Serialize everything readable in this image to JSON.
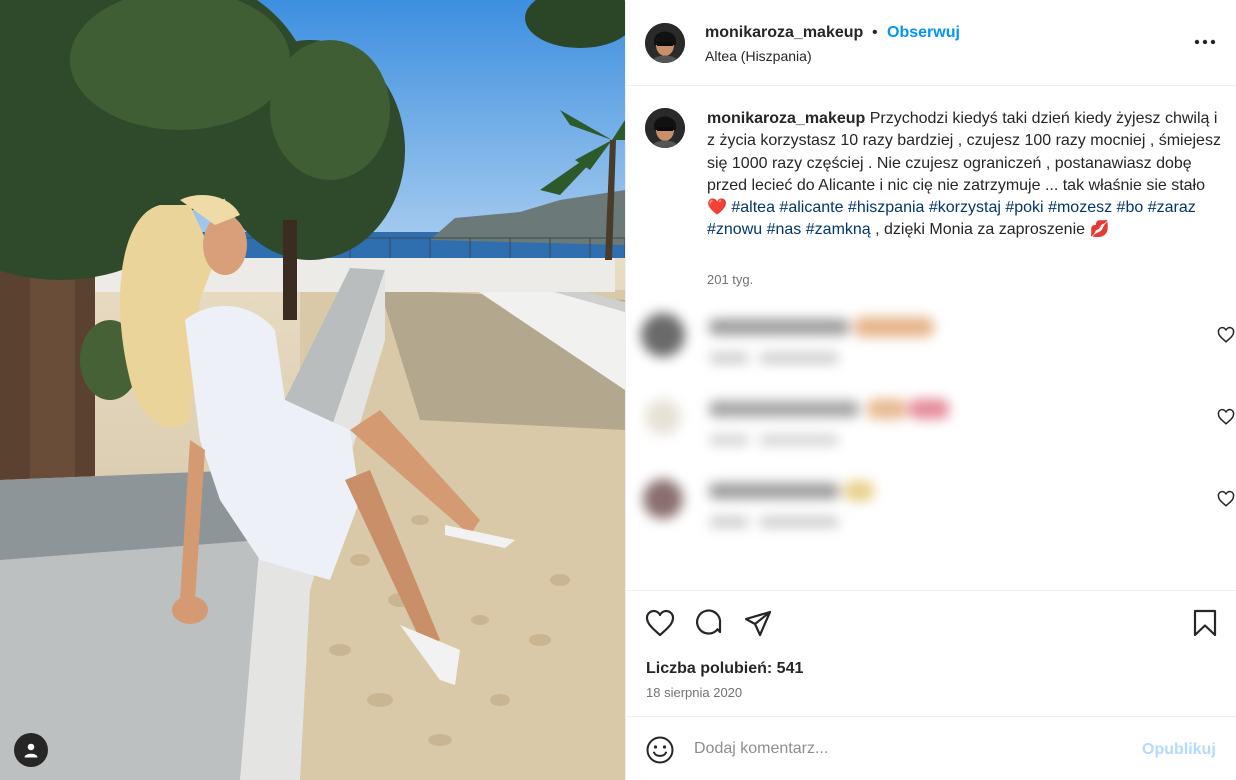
{
  "post": {
    "username": "monikaroza_makeup",
    "separator": "•",
    "follow_label": "Obserwuj",
    "location": "Altea (Hiszpania)",
    "more_icon": "more-options-icon",
    "caption": {
      "username": "monikaroza_makeup",
      "text_1": " Przychodzi kiedyś taki dzień kiedy żyjesz chwilą i z życia korzystasz 10 razy bardziej , czujesz 100 razy mocniej , śmiejesz się 1000 razy częściej . Nie czujesz ograniczeń , postanawiasz dobę przed lecieć do Alicante i nic cię nie zatrzymuje ... tak właśnie sie stało ",
      "emoji_heart": "❤️",
      "hashtags": [
        "#altea",
        "#alicante",
        "#hiszpania",
        "#korzystaj",
        "#poki",
        "#mozesz",
        "#bo",
        "#zaraz",
        "#znowu",
        "#nas",
        "#zamkną"
      ],
      "text_2": " , dzięki Monia za zaproszenie ",
      "emoji_lips": "💋",
      "time": "201 tyg."
    },
    "likes_label": "Liczba polubień: 541",
    "date": "18 sierpnia 2020",
    "comment_placeholder": "Dodaj komentarz...",
    "publish_label": "Opublikuj"
  },
  "colors": {
    "link_blue": "#0095f6",
    "hashtag_blue": "#00376b",
    "muted": "#737373",
    "publish_disabled": "#b3dbff"
  }
}
